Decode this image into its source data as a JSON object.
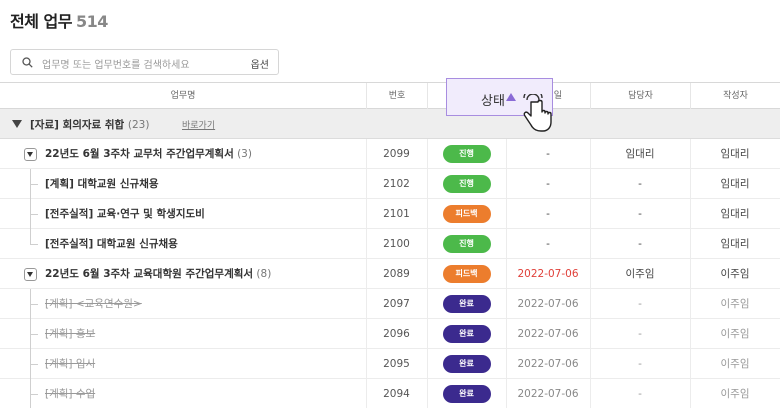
{
  "page": {
    "title": "전체 업무",
    "count": "514"
  },
  "search": {
    "placeholder": "업무명 또는 업무번호를 검색하세요",
    "options_label": "옵션"
  },
  "columns": {
    "task": "업무명",
    "number": "번호",
    "status": "상태",
    "date_partial": "일",
    "assignee": "담당자",
    "author": "작성자"
  },
  "group": {
    "title": "[자료] 회의자료 취합",
    "count": "(23)",
    "link": "바로가기"
  },
  "colors": {
    "green": "#4cb94a",
    "orange": "#ec7d2d",
    "purple": "#3b2a8e",
    "red": "#e0403a",
    "hover_bg": "#f1ecfc",
    "hover_border": "#a88de0"
  },
  "rows": [
    {
      "title": "22년도 6월 3주차 교무처 주간업무계획서",
      "count": "(3)",
      "number": "2099",
      "status": "진행",
      "status_color": "#4cb94a",
      "date": "-",
      "assignee": "임대리",
      "author": "임대리"
    },
    {
      "title": "[계획] 대학교원 신규채용",
      "count": "",
      "number": "2102",
      "status": "진행",
      "status_color": "#4cb94a",
      "date": "-",
      "assignee": "-",
      "author": "임대리"
    },
    {
      "title": "[전주실적] 교육·연구 및 학생지도비",
      "count": "",
      "number": "2101",
      "status": "피드백",
      "status_color": "#ec7d2d",
      "date": "-",
      "assignee": "-",
      "author": "임대리"
    },
    {
      "title": "[전주실적] 대학교원 신규채용",
      "count": "",
      "number": "2100",
      "status": "진행",
      "status_color": "#4cb94a",
      "date": "-",
      "assignee": "-",
      "author": "임대리"
    },
    {
      "title": "22년도 6월 3주차 교육대학원 주간업무계획서",
      "count": "(8)",
      "number": "2089",
      "status": "피드백",
      "status_color": "#ec7d2d",
      "date": "2022-07-06",
      "assignee": "이주임",
      "author": "이주임"
    },
    {
      "title": "[계획] <교육연수원>",
      "count": "",
      "number": "2097",
      "status": "완료",
      "status_color": "#3b2a8e",
      "date": "2022-07-06",
      "assignee": "-",
      "author": "이주임"
    },
    {
      "title": "[계획] 홍보",
      "count": "",
      "number": "2096",
      "status": "완료",
      "status_color": "#3b2a8e",
      "date": "2022-07-06",
      "assignee": "-",
      "author": "이주임"
    },
    {
      "title": "[계획] 입시",
      "count": "",
      "number": "2095",
      "status": "완료",
      "status_color": "#3b2a8e",
      "date": "2022-07-06",
      "assignee": "-",
      "author": "이주임"
    },
    {
      "title": "[계획] 수업",
      "count": "",
      "number": "2094",
      "status": "완료",
      "status_color": "#3b2a8e",
      "date": "2022-07-06",
      "assignee": "-",
      "author": "이주임"
    }
  ],
  "icons": {
    "search": "search-icon",
    "cursor": "pointer-hand-icon",
    "sort": "sort-asc-icon"
  }
}
